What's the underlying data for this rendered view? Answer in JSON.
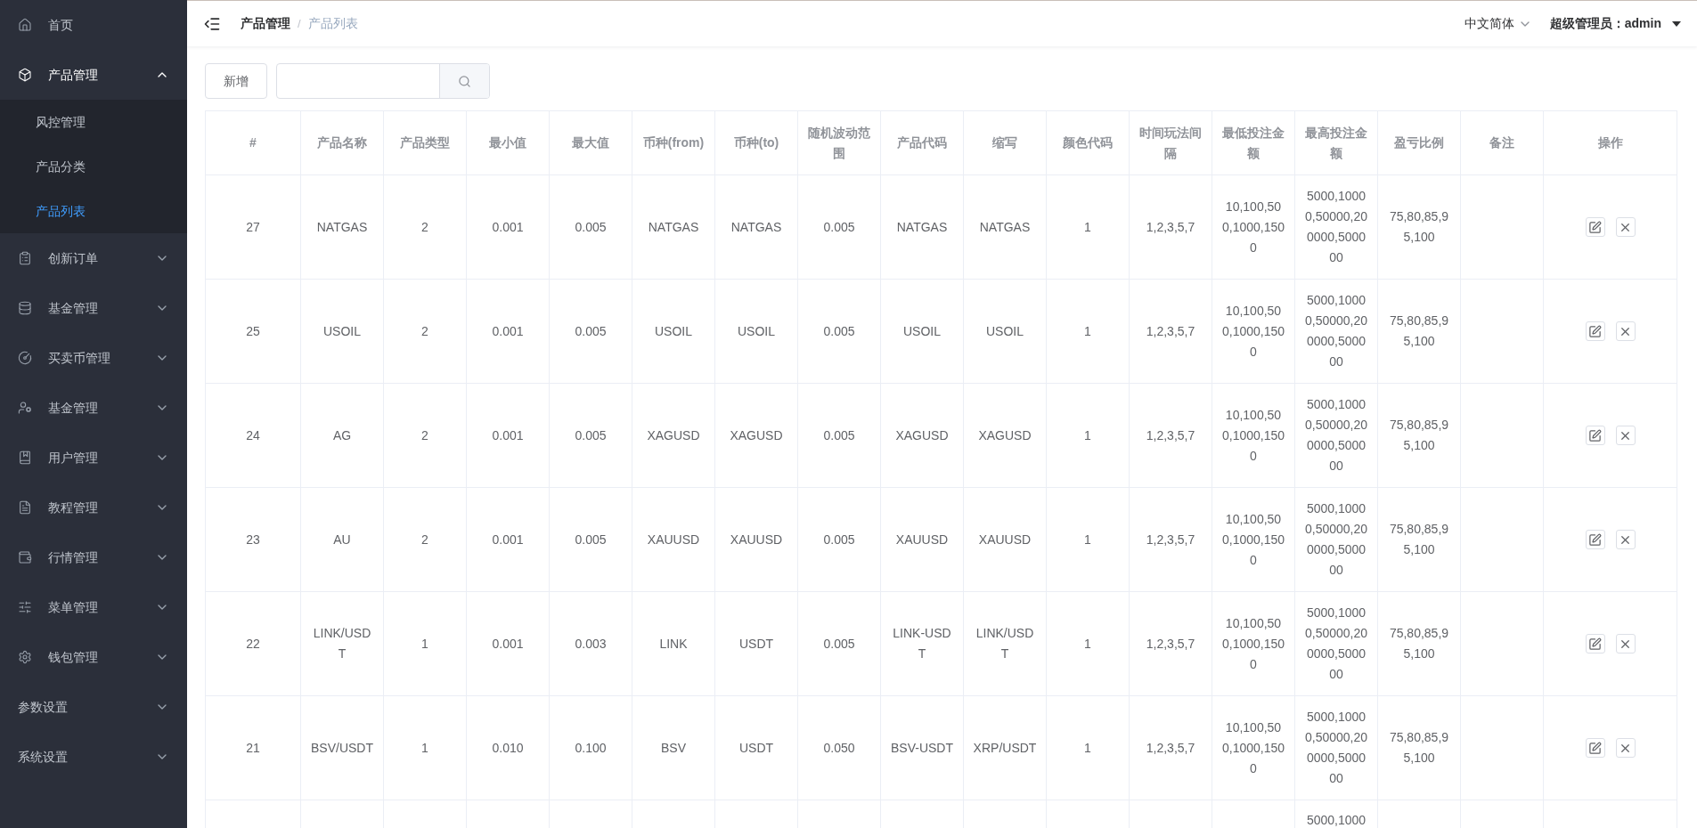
{
  "sidebar": {
    "items": [
      {
        "label": "首页",
        "expanded": false,
        "has_arrow": false
      },
      {
        "label": "产品管理",
        "expanded": true,
        "has_arrow": true,
        "children": [
          {
            "label": "风控管理",
            "selected": false
          },
          {
            "label": "产品分类",
            "selected": false
          },
          {
            "label": "产品列表",
            "selected": true
          }
        ]
      },
      {
        "label": "创新订单",
        "expanded": false,
        "has_arrow": true
      },
      {
        "label": "基金管理",
        "expanded": false,
        "has_arrow": true
      },
      {
        "label": "买卖币管理",
        "expanded": false,
        "has_arrow": true
      },
      {
        "label": "基金管理",
        "expanded": false,
        "has_arrow": true
      },
      {
        "label": "用户管理",
        "expanded": false,
        "has_arrow": true
      },
      {
        "label": "教程管理",
        "expanded": false,
        "has_arrow": true
      },
      {
        "label": "行情管理",
        "expanded": false,
        "has_arrow": true
      },
      {
        "label": "菜单管理",
        "expanded": false,
        "has_arrow": true
      },
      {
        "label": "钱包管理",
        "expanded": false,
        "has_arrow": true
      },
      {
        "label": "参数设置",
        "expanded": false,
        "has_arrow": true
      },
      {
        "label": "系统设置",
        "expanded": false,
        "has_arrow": true
      }
    ]
  },
  "header": {
    "breadcrumb": [
      {
        "label": "产品管理"
      },
      {
        "label": "产品列表"
      }
    ],
    "separator": "/",
    "language": "中文简体",
    "user": "超级管理员：admin"
  },
  "toolbar": {
    "add_button": "新增"
  },
  "table": {
    "columns": [
      "#",
      "产品名称",
      "产品类型",
      "最小值",
      "最大值",
      "币种(from)",
      "币种(to)",
      "随机波动范围",
      "产品代码",
      "缩写",
      "颜色代码",
      "时间玩法间隔",
      "最低投注金额",
      "最高投注金额",
      "盈亏比例",
      "备注",
      "操作"
    ],
    "rows": [
      {
        "kind": "full",
        "id": "27",
        "name": "NATGAS",
        "type": "2",
        "min": "0.001",
        "max": "0.005",
        "from": "NATGAS",
        "to": "NATGAS",
        "range": "0.005",
        "code": "NATGAS",
        "abbr": "NATGAS",
        "color_code": "1",
        "interval": "1,2,3,5,7",
        "min_bet": "10,100,500,1000,1500",
        "max_bet": "5000,10000,50000,200000,500000",
        "ratio": "75,80,85,95,100"
      },
      {
        "kind": "full",
        "id": "25",
        "name": "USOIL",
        "type": "2",
        "min": "0.001",
        "max": "0.005",
        "from": "USOIL",
        "to": "USOIL",
        "range": "0.005",
        "code": "USOIL",
        "abbr": "USOIL",
        "color_code": "1",
        "interval": "1,2,3,5,7",
        "min_bet": "10,100,500,1000,1500",
        "max_bet": "5000,10000,50000,200000,500000",
        "ratio": "75,80,85,95,100"
      },
      {
        "kind": "full",
        "id": "24",
        "name": "AG",
        "type": "2",
        "min": "0.001",
        "max": "0.005",
        "from": "XAGUSD",
        "to": "XAGUSD",
        "range": "0.005",
        "code": "XAGUSD",
        "abbr": "XAGUSD",
        "color_code": "1",
        "interval": "1,2,3,5,7",
        "min_bet": "10,100,500,1000,1500",
        "max_bet": "5000,10000,50000,200000,500000",
        "ratio": "75,80,85,95,100"
      },
      {
        "kind": "full",
        "id": "23",
        "name": "AU",
        "type": "2",
        "min": "0.001",
        "max": "0.005",
        "from": "XAUUSD",
        "to": "XAUUSD",
        "range": "0.005",
        "code": "XAUUSD",
        "abbr": "XAUUSD",
        "color_code": "1",
        "interval": "1,2,3,5,7",
        "min_bet": "10,100,500,1000,1500",
        "max_bet": "5000,10000,50000,200000,500000",
        "ratio": "75,80,85,95,100"
      },
      {
        "kind": "full",
        "id": "22",
        "name": "LINK/USDT",
        "type": "1",
        "min": "0.001",
        "max": "0.003",
        "from": "LINK",
        "to": "USDT",
        "range": "0.005",
        "code": "LINK-USDT",
        "abbr": "LINK/USDT",
        "color_code": "1",
        "interval": "1,2,3,5,7",
        "min_bet": "10,100,500,1000,1500",
        "max_bet": "5000,10000,50000,200000,500000",
        "ratio": "75,80,85,95,100"
      },
      {
        "kind": "full",
        "id": "21",
        "name": "BSV/USDT",
        "type": "1",
        "min": "0.010",
        "max": "0.100",
        "from": "BSV",
        "to": "USDT",
        "range": "0.050",
        "code": "BSV-USDT",
        "abbr": "XRP/USDT",
        "color_code": "1",
        "interval": "1,2,3,5,7",
        "min_bet": "10,100,500,1000,1500",
        "max_bet": "5000,10000,50000,200000,500000",
        "ratio": "75,80,85,95,100"
      },
      {
        "kind": "cut_off",
        "max_bet": "5000,1000"
      }
    ]
  }
}
